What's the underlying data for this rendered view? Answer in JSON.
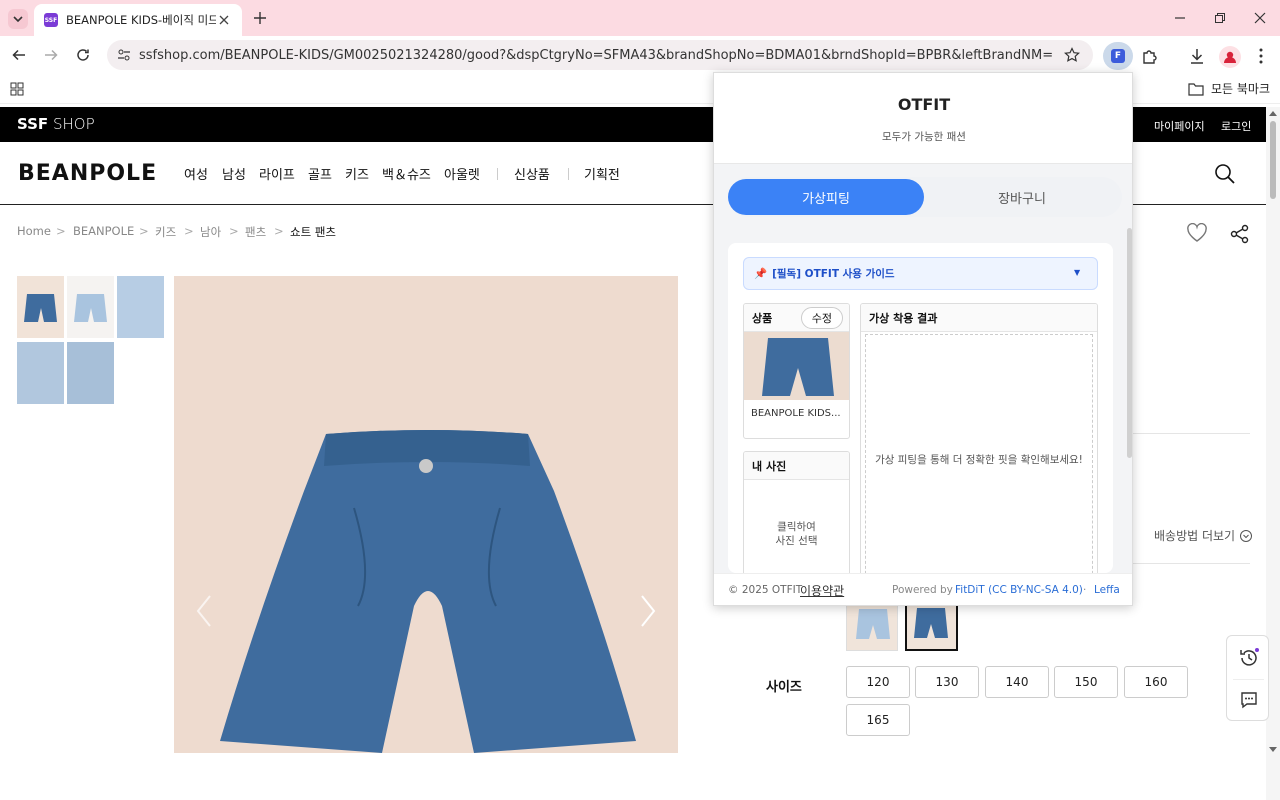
{
  "browser": {
    "tab_title": "BEANPOLE KIDS-베이직 미드트",
    "favicon_text": "SSF",
    "url": "ssfshop.com/BEANPOLE-KIDS/GM0025021324280/good?&dspCtgryNo=SFMA43&brandShopNo=BDMA01&brndShopId=BPBR&leftBrandNM=",
    "bookmarks_label": "모든 북마크",
    "extension_badge": "F"
  },
  "site": {
    "logo_bold": "SSF",
    "logo_light": "SHOP",
    "mypage": "마이페이지",
    "login": "로그인",
    "brand_logo": "BEANPOLE",
    "nav": [
      "여성",
      "남성",
      "라이프",
      "골프",
      "키즈",
      "백＆슈즈",
      "아울렛",
      "신상품",
      "기획전"
    ],
    "breadcrumb": [
      "Home",
      "BEANPOLE",
      "키즈",
      "남아",
      "팬츠",
      "쇼트 팬츠"
    ],
    "shipping_more": "배송방법 더보기",
    "size_label": "사이즈",
    "sizes": [
      "120",
      "130",
      "140",
      "150",
      "160",
      "165"
    ]
  },
  "popup": {
    "title": "OTFIT",
    "subtitle": "모두가 가능한 패션",
    "tab_active": "가상피팅",
    "tab_inactive": "장바구니",
    "guide": "[필독] OTFIT 사용 가이드",
    "product_label": "상품",
    "edit_button": "수정",
    "product_name": "BEANPOLE KIDS...",
    "result_label": "가상 착용 결과",
    "result_hint": "가상 피팅을 통해 더 정확한 핏을 확인해보세요!",
    "my_photo_label": "내 사진",
    "my_photo_hint_1": "클릭하여",
    "my_photo_hint_2": "사진 선택",
    "footer_copyright": "© 2025 OTFIT",
    "footer_terms": "이용약관",
    "footer_powered": "Powered by",
    "footer_fitdit": "FitDiT (CC BY-NC-SA 4.0)",
    "footer_sep": "·",
    "footer_leffa": "Leffa"
  },
  "colors": {
    "accent_blue": "#3b82f6",
    "tab_strip": "#fcdbe2",
    "image_bg": "#eedbcf",
    "denim": "#3f6c9e"
  }
}
